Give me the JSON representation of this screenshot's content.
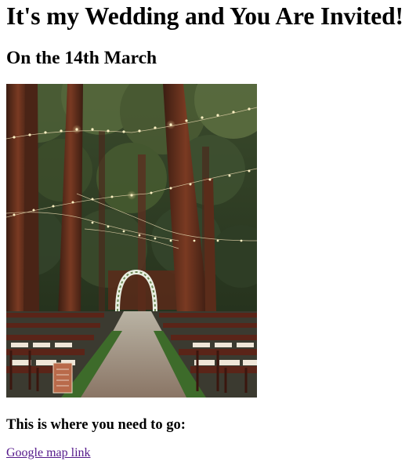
{
  "page": {
    "title": "It's my Wedding and You Are Invited!",
    "subtitle": "On the 14th March",
    "photo_alt": "forest wedding venue",
    "directions_heading": "This is where you need to go:",
    "map_link_label": "Google map link"
  },
  "colors": {
    "link_visited": "#551a8b",
    "text": "#000000",
    "background": "#ffffff"
  }
}
